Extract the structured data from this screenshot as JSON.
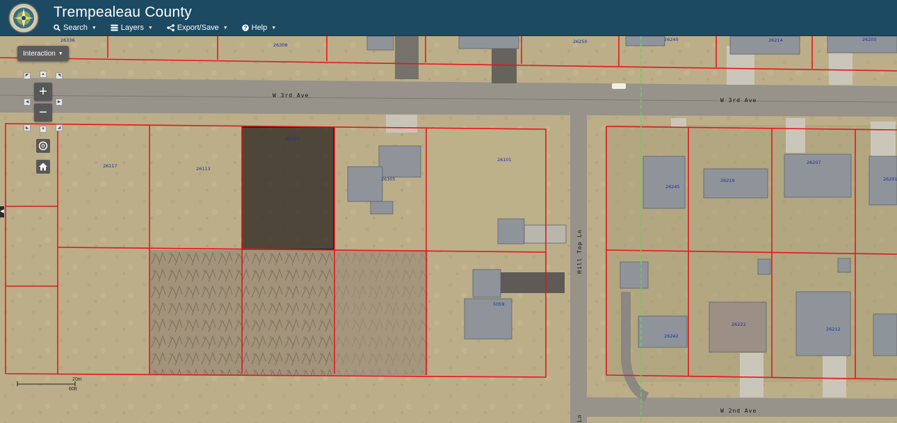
{
  "header": {
    "title": "Trempealeau County",
    "menu": [
      {
        "label": "Search",
        "icon": "search-icon"
      },
      {
        "label": "Layers",
        "icon": "layers-icon"
      },
      {
        "label": "Export/Save",
        "icon": "share-icon"
      },
      {
        "label": "Help",
        "icon": "help-icon"
      }
    ]
  },
  "map": {
    "interaction_label": "Interaction",
    "zoom_in": "+",
    "zoom_out": "−",
    "streets": {
      "w3rd_left": "W 3rd Ave",
      "w3rd_right": "W 3rd Ave",
      "w2nd": "W 2nd Ave",
      "hilltop": "Hill Top Ln",
      "hilltop_bottom": "Ln"
    },
    "parcel_ids": {
      "p26336": "26336",
      "p26308": "26308",
      "p26250": "26250",
      "p26240": "26240",
      "p26214": "26214",
      "p26200": "26200",
      "p26307": "26307",
      "p26117": "26117",
      "p26113": "26113",
      "p26305": "26305",
      "p26101": "26101",
      "p26245": "26245",
      "p26219": "26219",
      "p26207": "26207",
      "p26201": "26201",
      "p26222": "26222",
      "p26242": "26242",
      "p26212": "26212",
      "p5059": "5059"
    },
    "scale": {
      "metric": "20m",
      "imperial": "60ft"
    },
    "colors": {
      "parcel_line": "#e8141c",
      "selected_fill": "#2f2a22",
      "header": "#1b4a62"
    }
  }
}
